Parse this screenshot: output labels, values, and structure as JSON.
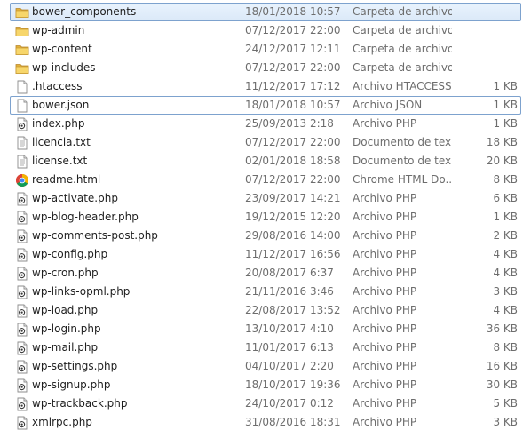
{
  "files": [
    {
      "name": "bower_components",
      "date": "18/01/2018 10:57",
      "type": "Carpeta de archivos",
      "size": "",
      "icon": "folder-icon",
      "state": "selected"
    },
    {
      "name": "wp-admin",
      "date": "07/12/2017 22:00",
      "type": "Carpeta de archivos",
      "size": "",
      "icon": "folder-icon",
      "state": ""
    },
    {
      "name": "wp-content",
      "date": "24/12/2017 12:11",
      "type": "Carpeta de archivos",
      "size": "",
      "icon": "folder-icon",
      "state": ""
    },
    {
      "name": "wp-includes",
      "date": "07/12/2017 22:00",
      "type": "Carpeta de archivos",
      "size": "",
      "icon": "folder-icon",
      "state": ""
    },
    {
      "name": ".htaccess",
      "date": "11/12/2017 17:12",
      "type": "Archivo HTACCESS",
      "size": "1 KB",
      "icon": "blank-file-icon",
      "state": ""
    },
    {
      "name": "bower.json",
      "date": "18/01/2018 10:57",
      "type": "Archivo JSON",
      "size": "1 KB",
      "icon": "blank-file-icon",
      "state": "focused"
    },
    {
      "name": "index.php",
      "date": "25/09/2013 2:18",
      "type": "Archivo PHP",
      "size": "1 KB",
      "icon": "php-file-icon",
      "state": ""
    },
    {
      "name": "licencia.txt",
      "date": "07/12/2017 22:00",
      "type": "Documento de tex...",
      "size": "18 KB",
      "icon": "text-file-icon",
      "state": ""
    },
    {
      "name": "license.txt",
      "date": "02/01/2018 18:58",
      "type": "Documento de tex...",
      "size": "20 KB",
      "icon": "text-file-icon",
      "state": ""
    },
    {
      "name": "readme.html",
      "date": "07/12/2017 22:00",
      "type": "Chrome HTML Do...",
      "size": "8 KB",
      "icon": "chrome-icon",
      "state": ""
    },
    {
      "name": "wp-activate.php",
      "date": "23/09/2017 14:21",
      "type": "Archivo PHP",
      "size": "6 KB",
      "icon": "php-file-icon",
      "state": ""
    },
    {
      "name": "wp-blog-header.php",
      "date": "19/12/2015 12:20",
      "type": "Archivo PHP",
      "size": "1 KB",
      "icon": "php-file-icon",
      "state": ""
    },
    {
      "name": "wp-comments-post.php",
      "date": "29/08/2016 14:00",
      "type": "Archivo PHP",
      "size": "2 KB",
      "icon": "php-file-icon",
      "state": ""
    },
    {
      "name": "wp-config.php",
      "date": "11/12/2017 16:56",
      "type": "Archivo PHP",
      "size": "4 KB",
      "icon": "php-file-icon",
      "state": ""
    },
    {
      "name": "wp-cron.php",
      "date": "20/08/2017 6:37",
      "type": "Archivo PHP",
      "size": "4 KB",
      "icon": "php-file-icon",
      "state": ""
    },
    {
      "name": "wp-links-opml.php",
      "date": "21/11/2016 3:46",
      "type": "Archivo PHP",
      "size": "3 KB",
      "icon": "php-file-icon",
      "state": ""
    },
    {
      "name": "wp-load.php",
      "date": "22/08/2017 13:52",
      "type": "Archivo PHP",
      "size": "4 KB",
      "icon": "php-file-icon",
      "state": ""
    },
    {
      "name": "wp-login.php",
      "date": "13/10/2017 4:10",
      "type": "Archivo PHP",
      "size": "36 KB",
      "icon": "php-file-icon",
      "state": ""
    },
    {
      "name": "wp-mail.php",
      "date": "11/01/2017 6:13",
      "type": "Archivo PHP",
      "size": "8 KB",
      "icon": "php-file-icon",
      "state": ""
    },
    {
      "name": "wp-settings.php",
      "date": "04/10/2017 2:20",
      "type": "Archivo PHP",
      "size": "16 KB",
      "icon": "php-file-icon",
      "state": ""
    },
    {
      "name": "wp-signup.php",
      "date": "18/10/2017 19:36",
      "type": "Archivo PHP",
      "size": "30 KB",
      "icon": "php-file-icon",
      "state": ""
    },
    {
      "name": "wp-trackback.php",
      "date": "24/10/2017 0:12",
      "type": "Archivo PHP",
      "size": "5 KB",
      "icon": "php-file-icon",
      "state": ""
    },
    {
      "name": "xmlrpc.php",
      "date": "31/08/2016 18:31",
      "type": "Archivo PHP",
      "size": "3 KB",
      "icon": "php-file-icon",
      "state": ""
    }
  ]
}
